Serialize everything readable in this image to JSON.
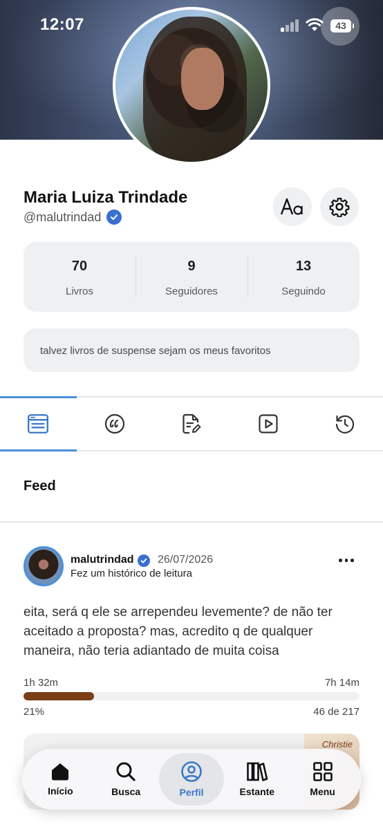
{
  "status_bar": {
    "time": "12:07",
    "battery": "43"
  },
  "profile": {
    "name": "Maria Luiza Trindade",
    "handle": "@malutrindad",
    "stats": [
      {
        "value": "70",
        "label": "Livros"
      },
      {
        "value": "9",
        "label": "Seguidores"
      },
      {
        "value": "13",
        "label": "Seguindo"
      }
    ],
    "bio": "talvez livros de suspense sejam os meus favoritos"
  },
  "feed": {
    "title": "Feed",
    "post": {
      "user": "malutrindad",
      "date": "26/07/2026",
      "action": "Fez um histórico de leitura",
      "text": "eita, será q ele se arrependeu levemente? de não ter aceitado a proposta? mas, acredito q de qualquer maneira, não teria adiantado de muita coisa",
      "time_read": "1h 32m",
      "time_total": "7h 14m",
      "percent_label": "21%",
      "progress": 0.21,
      "pages": "46 de 217",
      "book_cover_text": "Christie"
    }
  },
  "nav": {
    "items": [
      {
        "label": "Início",
        "icon": "home-icon"
      },
      {
        "label": "Busca",
        "icon": "search-icon"
      },
      {
        "label": "Perfil",
        "icon": "profile-icon"
      },
      {
        "label": "Estante",
        "icon": "bookshelf-icon"
      },
      {
        "label": "Menu",
        "icon": "grid-icon"
      }
    ],
    "active": "Perfil"
  },
  "colors": {
    "accent": "#4a90d9",
    "verified": "#3a6fd0",
    "progress": "#7a3f14"
  }
}
